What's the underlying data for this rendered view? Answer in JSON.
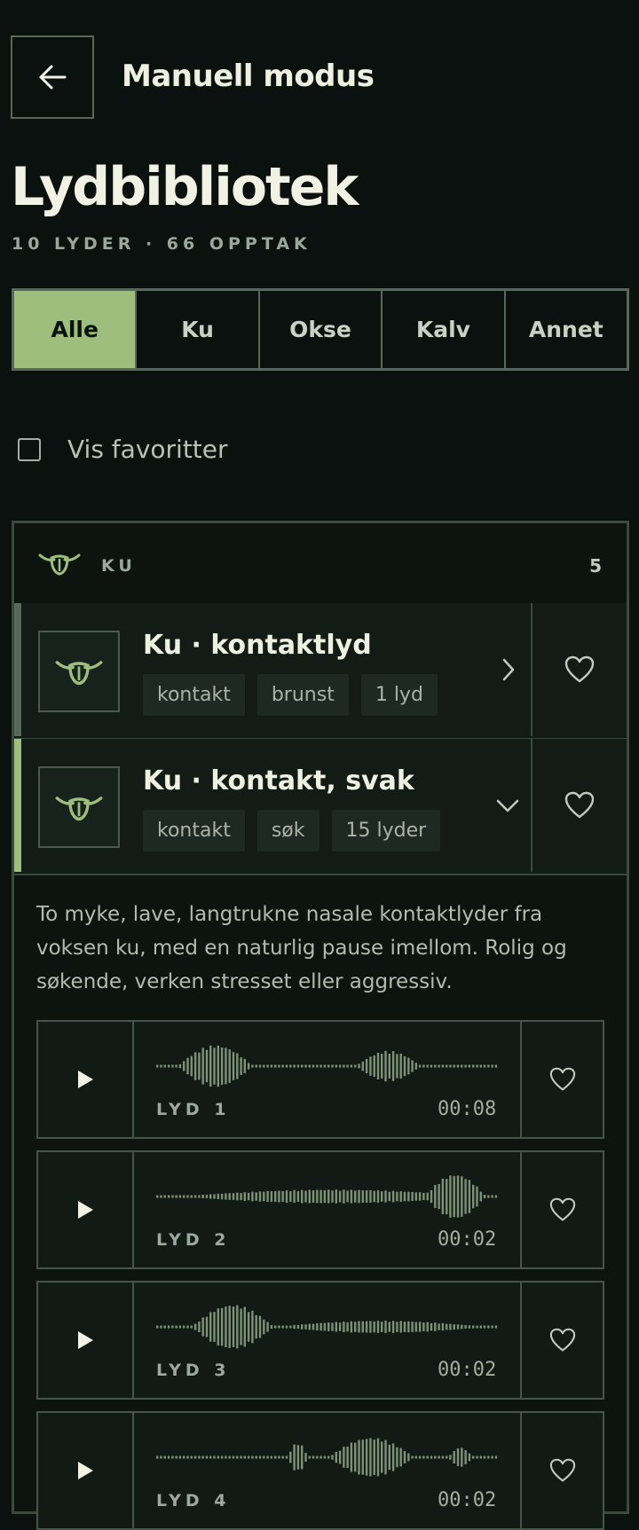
{
  "header": {
    "title": "Manuell modus",
    "back_icon": "arrow-left-icon"
  },
  "page": {
    "title": "Lydbibliotek",
    "subtitle": "10 LYDER · 66 OPPTAK"
  },
  "filter_tabs": [
    {
      "label": "Alle",
      "active": true
    },
    {
      "label": "Ku",
      "active": false
    },
    {
      "label": "Okse",
      "active": false
    },
    {
      "label": "Kalv",
      "active": false
    },
    {
      "label": "Annet",
      "active": false
    }
  ],
  "favorites_toggle": {
    "label": "Vis favoritter",
    "checked": false
  },
  "group": {
    "label": "KU",
    "count": "5",
    "icon": "cow-head-icon",
    "sounds": [
      {
        "title": "Ku · kontaktlyd",
        "tags": [
          "kontakt",
          "brunst",
          "1 lyd"
        ],
        "expanded": false,
        "accent": "#56695b"
      },
      {
        "title": "Ku · kontakt, svak",
        "tags": [
          "kontakt",
          "søk",
          "15 lyder"
        ],
        "expanded": true,
        "accent": "#9ebe7e"
      }
    ],
    "description": "To myke, lave, langtrukne nasale kontaktlyder fra voksen ku, med en naturlig pause imellom. Rolig og søkende, verken stresset eller aggressiv.",
    "clips": [
      {
        "label": "LYD 1",
        "duration": "00:08"
      },
      {
        "label": "LYD 2",
        "duration": "00:02"
      },
      {
        "label": "LYD 3",
        "duration": "00:02"
      },
      {
        "label": "LYD 4",
        "duration": "00:02"
      }
    ]
  },
  "colors": {
    "background": "#0b110e",
    "accent": "#9ebe7e",
    "border": "#56695b",
    "waveform": "#7d9276"
  }
}
